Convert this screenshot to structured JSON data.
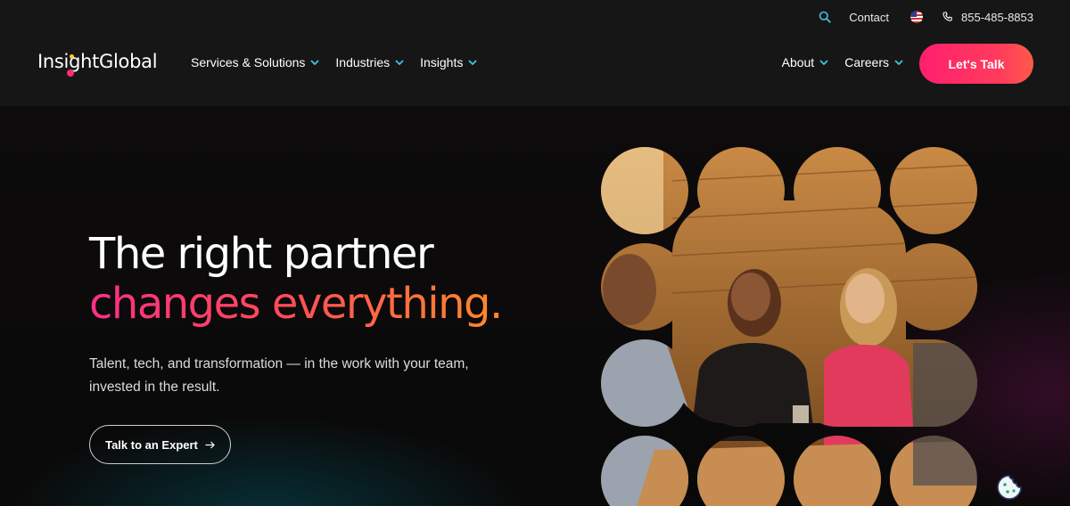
{
  "header": {
    "logo_text": "InsightGlobal",
    "utility": {
      "search_icon": "search-icon",
      "contact_label": "Contact",
      "flag_icon": "us-flag-icon",
      "phone_icon": "phone-icon",
      "phone_number": "855-485-8853"
    },
    "nav_left": [
      {
        "label": "Services & Solutions"
      },
      {
        "label": "Industries"
      },
      {
        "label": "Insights"
      }
    ],
    "nav_right": [
      {
        "label": "About"
      },
      {
        "label": "Careers"
      }
    ],
    "cta_label": "Let's Talk"
  },
  "hero": {
    "headline_line1": "The right partner",
    "headline_line2": "changes everything.",
    "subtext": "Talent, tech, and transformation — in the work with your team, invested in the result.",
    "button_label": "Talk to an Expert",
    "button_icon": "arrow-right-icon",
    "image_icon": "photo-people-meeting"
  },
  "colors": {
    "accent_pink": "#ff1f6e",
    "accent_orange": "#ff8a2a",
    "chevron_cyan": "#3ec6e0",
    "header_bg": "#161616"
  },
  "cookie_icon": "cookie-icon"
}
